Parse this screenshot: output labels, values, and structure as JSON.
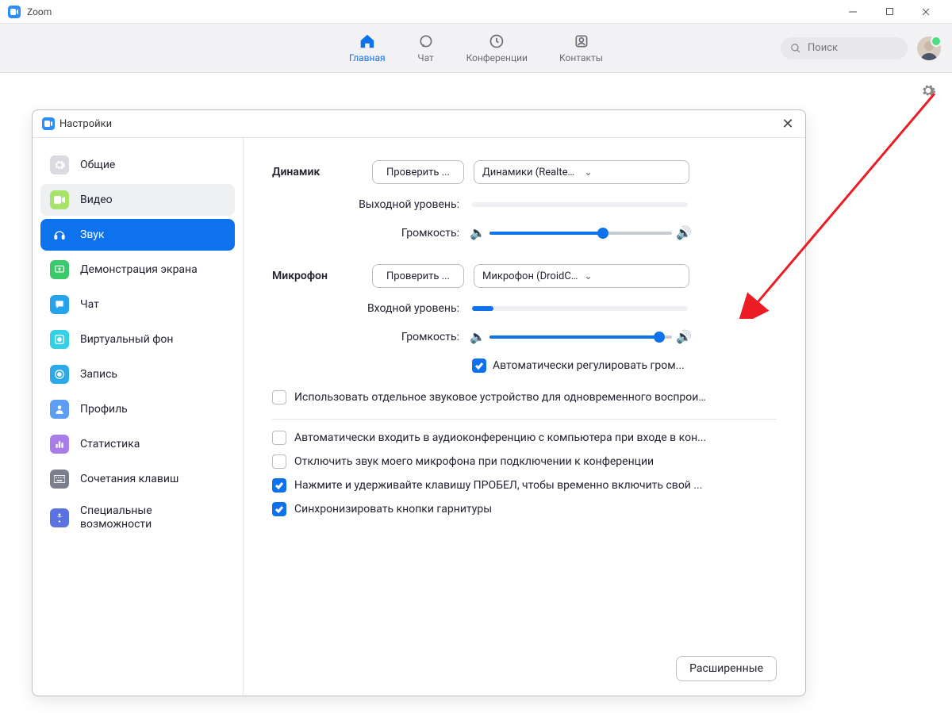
{
  "window": {
    "title": "Zoom"
  },
  "nav": {
    "items": [
      {
        "key": "home",
        "label": "Главная"
      },
      {
        "key": "chat",
        "label": "Чат"
      },
      {
        "key": "meetings",
        "label": "Конференции"
      },
      {
        "key": "contacts",
        "label": "Контакты"
      }
    ],
    "search_placeholder": "Поиск"
  },
  "dialog": {
    "title": "Настройки"
  },
  "sidebar": {
    "items": [
      {
        "key": "general",
        "label": "Общие",
        "icon_bg": "#d9dbe0",
        "icon_color": "#fff"
      },
      {
        "key": "video",
        "label": "Видео",
        "icon_bg": "#a7e36a",
        "icon_color": "#fff"
      },
      {
        "key": "audio",
        "label": "Звук",
        "icon_bg": "#0e72ed",
        "icon_color": "#fff"
      },
      {
        "key": "share",
        "label": "Демонстрация экрана",
        "icon_bg": "#3cc96b",
        "icon_color": "#fff"
      },
      {
        "key": "chat",
        "label": "Чат",
        "icon_bg": "#26a3ec",
        "icon_color": "#fff"
      },
      {
        "key": "vb",
        "label": "Виртуальный фон",
        "icon_bg": "#34d0e6",
        "icon_color": "#fff"
      },
      {
        "key": "record",
        "label": "Запись",
        "icon_bg": "#2ea9e8",
        "icon_color": "#fff"
      },
      {
        "key": "profile",
        "label": "Профиль",
        "icon_bg": "#5c9ef1",
        "icon_color": "#fff"
      },
      {
        "key": "stats",
        "label": "Статистика",
        "icon_bg": "#a97ce8",
        "icon_color": "#fff"
      },
      {
        "key": "shortcuts",
        "label": "Сочетания клавиш",
        "icon_bg": "#7b7f8c",
        "icon_color": "#fff"
      },
      {
        "key": "access",
        "label": "Специальные возможности",
        "icon_bg": "#5a73e0",
        "icon_color": "#fff"
      }
    ],
    "active_key": "audio"
  },
  "audio": {
    "speaker": {
      "section_label": "Динамик",
      "test_label": "Проверить ...",
      "device": "Динамики (Realtek High Definitio...",
      "output_level_label": "Выходной уровень:",
      "output_level_pct": 0,
      "volume_label": "Громкость:",
      "volume_pct": 62
    },
    "mic": {
      "section_label": "Микрофон",
      "test_label": "Проверить ...",
      "device": "Микрофон (DroidCam Virtual Au...",
      "input_level_label": "Входной уровень:",
      "input_level_pct": 10,
      "volume_label": "Громкость:",
      "volume_pct": 93,
      "auto_adjust_label": "Автоматически регулировать гром..."
    },
    "separate_device_label": "Использовать отдельное звуковое устройство для одновременного воспрои...",
    "options": [
      {
        "key": "auto_join",
        "label": "Автоматически входить в аудиоконференцию с компьютера при входе в кон...",
        "checked": false
      },
      {
        "key": "mute_on_join",
        "label": "Отключить звук моего микрофона при подключении к конференции",
        "checked": false
      },
      {
        "key": "space_unmute",
        "label": "Нажмите и удерживайте клавишу ПРОБЕЛ, чтобы временно включить свой ...",
        "checked": true
      },
      {
        "key": "sync_headset",
        "label": "Синхронизировать кнопки гарнитуры",
        "checked": true
      }
    ],
    "advanced_label": "Расширенные"
  }
}
